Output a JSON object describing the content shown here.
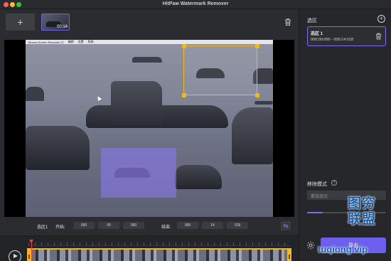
{
  "window": {
    "title": "HitPaw Watermark Remover"
  },
  "media_bar": {
    "add_symbol": "+",
    "thumbnail_duration": "00:14"
  },
  "video": {
    "menubar_items": [
      "Movavi Screen Recorder 22",
      "编辑",
      "设置",
      "帮助"
    ]
  },
  "controls": {
    "region_label": "选区1",
    "start_label": "开始:",
    "start_hh": "000",
    "start_mm": "00",
    "start_ss": "000",
    "end_label": "结束:",
    "end_hh": "000",
    "end_mm": "14",
    "end_ss": "018"
  },
  "sidebar": {
    "title": "选区",
    "add_symbol": "+",
    "regions": [
      {
        "name": "选区 1",
        "range": "000:00:000 - 000:14:018"
      }
    ],
    "mode_title": "移除模式",
    "mode_help": "?",
    "mode_value": "蒙版填充",
    "slider_level": 0.2,
    "remove_label": "导出"
  },
  "timeline": {
    "playhead_fraction": 0.01
  },
  "watermark": {
    "chars": "图穷联盟",
    "url": "tuqiong.vip"
  },
  "colors": {
    "accent": "#6d5ff0",
    "selection": "#f6b620",
    "playhead": "#ff3b2f"
  }
}
